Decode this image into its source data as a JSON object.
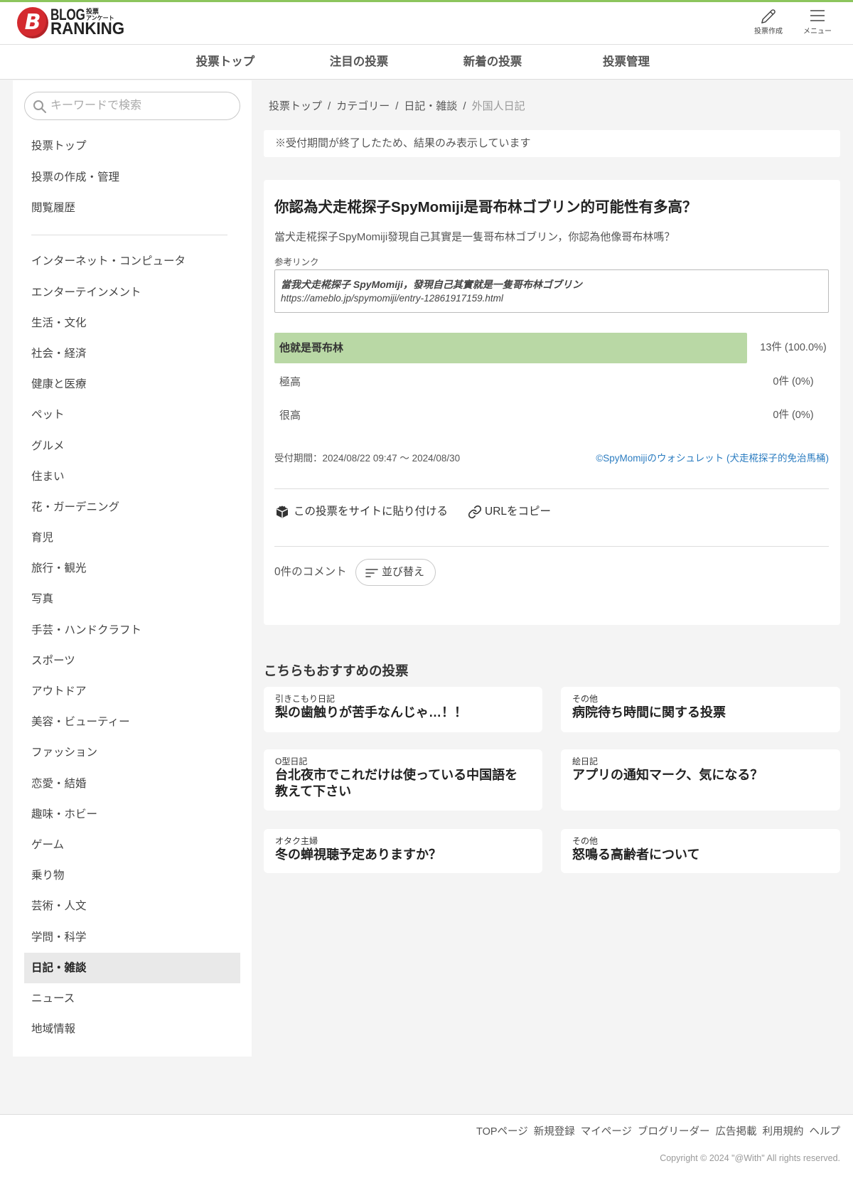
{
  "header": {
    "logo": {
      "mark": "B",
      "line1": "BLOG",
      "line2": "RANKING",
      "sub1": "投票",
      "sub2": "アンケート"
    },
    "create_label": "投票作成",
    "menu_label": "メニュー"
  },
  "nav": [
    "投票トップ",
    "注目の投票",
    "新着の投票",
    "投票管理"
  ],
  "search": {
    "placeholder": "キーワードで検索"
  },
  "sidebar": {
    "top_items": [
      "投票トップ",
      "投票の作成・管理",
      "閲覧履歴"
    ],
    "categories": [
      {
        "label": "インターネット・コンピュータ"
      },
      {
        "label": "エンターテインメント"
      },
      {
        "label": "生活・文化"
      },
      {
        "label": "社会・経済"
      },
      {
        "label": "健康と医療"
      },
      {
        "label": "ペット"
      },
      {
        "label": "グルメ"
      },
      {
        "label": "住まい"
      },
      {
        "label": "花・ガーデニング"
      },
      {
        "label": "育児"
      },
      {
        "label": "旅行・観光"
      },
      {
        "label": "写真"
      },
      {
        "label": "手芸・ハンドクラフト"
      },
      {
        "label": "スポーツ"
      },
      {
        "label": "アウトドア"
      },
      {
        "label": "美容・ビューティー"
      },
      {
        "label": "ファッション"
      },
      {
        "label": "恋愛・結婚"
      },
      {
        "label": "趣味・ホビー"
      },
      {
        "label": "ゲーム"
      },
      {
        "label": "乗り物"
      },
      {
        "label": "芸術・人文"
      },
      {
        "label": "学問・科学"
      },
      {
        "label": "日記・雑談",
        "active": true
      },
      {
        "label": "ニュース"
      },
      {
        "label": "地域情報"
      }
    ]
  },
  "breadcrumb": {
    "items": [
      "投票トップ",
      "カテゴリー",
      "日記・雑談",
      "外国人日記"
    ],
    "separator": "/"
  },
  "notice": "※受付期間が終了したため、結果のみ表示しています",
  "poll": {
    "title": "你認為犬走椛探子SpyMomiji是哥布林ゴブリン的可能性有多高？",
    "description": "當犬走椛探子SpyMomiji發現自己其實是一隻哥布林ゴブリン，你認為他像哥布林嗎？",
    "reference_label": "参考リンク",
    "reference": {
      "title": "當我犬走椛探子 SpyMomiji，發現自己其實就是一隻哥布林ゴブリン",
      "url": "https://ameblo.jp/spymomiji/entry-12861917159.html"
    },
    "results": [
      {
        "label": "他就是哥布林",
        "count_text": "13件 (100.0%)",
        "percent": 100
      },
      {
        "label": "極高",
        "count_text": "0件 (0%)",
        "percent": 0
      },
      {
        "label": "很高",
        "count_text": "0件 (0%)",
        "percent": 0
      }
    ],
    "period": "受付期間：2024/08/22 09:47 〜 2024/08/30",
    "author_link": "©SpyMomijiのウォシュレット (犬走椛探子的免治馬桶)",
    "embed_label": "この投票をサイトに貼り付ける",
    "copy_url_label": "URLをコピー",
    "comments_count": "0件のコメント",
    "sort_label": "並び替え"
  },
  "recommended": {
    "heading": "こちらもおすすめの投票",
    "items": [
      {
        "category": "引きこもり日記",
        "title": "梨の歯触りが苦手なんじゃ…！！"
      },
      {
        "category": "その他",
        "title": "病院待ち時間に関する投票"
      },
      {
        "category": "O型日記",
        "title": "台北夜市でこれだけは使っている中国語を教えて下さい"
      },
      {
        "category": "絵日記",
        "title": "アプリの通知マーク、気になる？"
      },
      {
        "category": "オタク主婦",
        "title": "冬の蝉視聴予定ありますか？"
      },
      {
        "category": "その他",
        "title": "怒鳴る高齢者について"
      }
    ]
  },
  "footer": {
    "links": [
      "TOPページ",
      "新規登録",
      "マイページ",
      "ブログリーダー",
      "広告掲載",
      "利用規約",
      "ヘルプ"
    ],
    "copyright": "Copyright © 2024 \"@With\" All rights reserved."
  },
  "colors": {
    "accent_green": "#8cc55d",
    "result_bar": "#b9d8a5",
    "link_blue": "#2b7cc0",
    "logo_red": "#d42a2f",
    "active_category_bg": "#e9e9e9"
  },
  "icons": {
    "search": "search-icon",
    "create": "pencil-icon",
    "menu": "hamburger-menu-icon",
    "embed": "embed-box-icon",
    "copy_url": "link-icon",
    "sort": "sort-icon"
  }
}
